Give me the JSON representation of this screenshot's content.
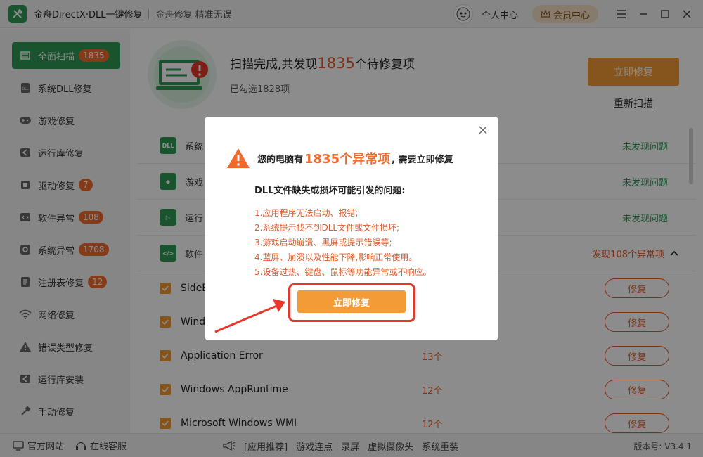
{
  "app": {
    "title": "金舟DirectX·DLL一键修复",
    "slogan": "金舟修复 精准无误",
    "personal_center": "个人中心",
    "vip_center": "会员中心",
    "colors": {
      "brand_green": "#2e9a57",
      "accent_orange": "#f39b36",
      "warn_red": "#e35a2a"
    }
  },
  "sidebar": {
    "items": [
      {
        "label": "全面扫描",
        "badge": "1835",
        "icon": "scan-icon"
      },
      {
        "label": "系统DLL修复",
        "badge": "",
        "icon": "dll-icon"
      },
      {
        "label": "游戏修复",
        "badge": "",
        "icon": "gamepad-icon"
      },
      {
        "label": "运行库修复",
        "badge": "",
        "icon": "runtime-icon"
      },
      {
        "label": "驱动修复",
        "badge": "7",
        "icon": "driver-icon"
      },
      {
        "label": "软件异常",
        "badge": "108",
        "icon": "code-icon"
      },
      {
        "label": "系统异常",
        "badge": "1708",
        "icon": "gear-icon"
      },
      {
        "label": "注册表修复",
        "badge": "12",
        "icon": "registry-icon"
      },
      {
        "label": "网络修复",
        "badge": "",
        "icon": "wifi-icon"
      },
      {
        "label": "错误类型修复",
        "badge": "",
        "icon": "warning-icon"
      },
      {
        "label": "运行库安装",
        "badge": "",
        "icon": "install-icon"
      },
      {
        "label": "手动修复",
        "badge": "",
        "icon": "wrench-icon"
      }
    ]
  },
  "main": {
    "scan_title_prefix": "扫描完成,共发现",
    "scan_count": "1835",
    "scan_title_suffix": "个待修复项",
    "selected": "已勾选1828项",
    "fix_now": "立即修复",
    "rescan": "重新扫描",
    "categories": [
      {
        "name": "系统",
        "status": "未发现问题",
        "icon_text": "DLL"
      },
      {
        "name": "游戏",
        "status": "未发现问题",
        "icon_text": "◆"
      },
      {
        "name": "运行",
        "status": "未发现问题",
        "icon_text": "▷"
      },
      {
        "name": "软件",
        "status": "发现108个异常项",
        "icon_text": "</>"
      }
    ],
    "items": [
      {
        "name": "SideB",
        "count": "",
        "fix": "修复"
      },
      {
        "name": "Wind",
        "count": "",
        "fix": "修复"
      },
      {
        "name": "Application Error",
        "count": "13个",
        "fix": "修复"
      },
      {
        "name": "Windows AppRuntime",
        "count": "12个",
        "fix": "修复"
      },
      {
        "name": "Microsoft Windows WMI",
        "count": "12个",
        "fix": "修复"
      }
    ]
  },
  "modal": {
    "head_prefix": "您的电脑有",
    "head_highlight": "1835个异常项",
    "head_suffix": ", 需要立即修复",
    "problem_title": "DLL文件缺失或损坏可能引发的问题:",
    "problems": [
      "1.应用程序无法启动、报错;",
      "2.系统提示找不到DLL文件或文件损坏;",
      "3.游戏启动崩溃、黑屏或提示错误等;",
      "4.蓝屏、崩溃以及性能下降,影响正常使用。",
      "5.设备过热、键盘、鼠标等功能异常或不响应。"
    ],
    "fix_button": "立即修复"
  },
  "bottom": {
    "official_site": "官方网站",
    "online_service": "在线客服",
    "recommend": "[应用推荐]",
    "links": [
      "游戏连点",
      "录屏",
      "虚拟摄像头",
      "系统重装"
    ],
    "version": "版本号: V3.4.1"
  }
}
